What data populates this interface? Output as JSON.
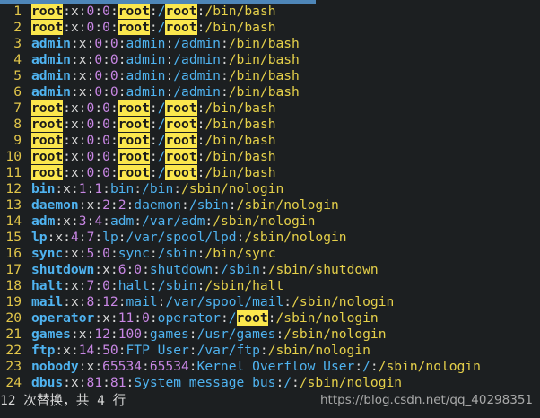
{
  "editor": {
    "lines": [
      {
        "n": "1",
        "user": "root",
        "uid": "0",
        "gid": "0",
        "gecos": "root",
        "home": "/root",
        "shell": "/bin/bash"
      },
      {
        "n": "2",
        "user": "root",
        "uid": "0",
        "gid": "0",
        "gecos": "root",
        "home": "/root",
        "shell": "/bin/bash"
      },
      {
        "n": "3",
        "user": "admin",
        "uid": "0",
        "gid": "0",
        "gecos": "admin",
        "home": "/admin",
        "shell": "/bin/bash"
      },
      {
        "n": "4",
        "user": "admin",
        "uid": "0",
        "gid": "0",
        "gecos": "admin",
        "home": "/admin",
        "shell": "/bin/bash"
      },
      {
        "n": "5",
        "user": "admin",
        "uid": "0",
        "gid": "0",
        "gecos": "admin",
        "home": "/admin",
        "shell": "/bin/bash"
      },
      {
        "n": "6",
        "user": "admin",
        "uid": "0",
        "gid": "0",
        "gecos": "admin",
        "home": "/admin",
        "shell": "/bin/bash"
      },
      {
        "n": "7",
        "user": "root",
        "uid": "0",
        "gid": "0",
        "gecos": "root",
        "home": "/root",
        "shell": "/bin/bash"
      },
      {
        "n": "8",
        "user": "root",
        "uid": "0",
        "gid": "0",
        "gecos": "root",
        "home": "/root",
        "shell": "/bin/bash"
      },
      {
        "n": "9",
        "user": "root",
        "uid": "0",
        "gid": "0",
        "gecos": "root",
        "home": "/root",
        "shell": "/bin/bash"
      },
      {
        "n": "10",
        "user": "root",
        "uid": "0",
        "gid": "0",
        "gecos": "root",
        "home": "/root",
        "shell": "/bin/bash"
      },
      {
        "n": "11",
        "user": "root",
        "uid": "0",
        "gid": "0",
        "gecos": "root",
        "home": "/root",
        "shell": "/bin/bash"
      },
      {
        "n": "12",
        "user": "bin",
        "uid": "1",
        "gid": "1",
        "gecos": "bin",
        "home": "/bin",
        "shell": "/sbin/nologin"
      },
      {
        "n": "13",
        "user": "daemon",
        "uid": "2",
        "gid": "2",
        "gecos": "daemon",
        "home": "/sbin",
        "shell": "/sbin/nologin"
      },
      {
        "n": "14",
        "user": "adm",
        "uid": "3",
        "gid": "4",
        "gecos": "adm",
        "home": "/var/adm",
        "shell": "/sbin/nologin"
      },
      {
        "n": "15",
        "user": "lp",
        "uid": "4",
        "gid": "7",
        "gecos": "lp",
        "home": "/var/spool/lpd",
        "shell": "/sbin/nologin"
      },
      {
        "n": "16",
        "user": "sync",
        "uid": "5",
        "gid": "0",
        "gecos": "sync",
        "home": "/sbin",
        "shell": "/bin/sync"
      },
      {
        "n": "17",
        "user": "shutdown",
        "uid": "6",
        "gid": "0",
        "gecos": "shutdown",
        "home": "/sbin",
        "shell": "/sbin/shutdown"
      },
      {
        "n": "18",
        "user": "halt",
        "uid": "7",
        "gid": "0",
        "gecos": "halt",
        "home": "/sbin",
        "shell": "/sbin/halt"
      },
      {
        "n": "19",
        "user": "mail",
        "uid": "8",
        "gid": "12",
        "gecos": "mail",
        "home": "/var/spool/mail",
        "shell": "/sbin/nologin"
      },
      {
        "n": "20",
        "user": "operator",
        "uid": "11",
        "gid": "0",
        "gecos": "operator",
        "home": "/root",
        "shell": "/sbin/nologin"
      },
      {
        "n": "21",
        "user": "games",
        "uid": "12",
        "gid": "100",
        "gecos": "games",
        "home": "/usr/games",
        "shell": "/sbin/nologin"
      },
      {
        "n": "22",
        "user": "ftp",
        "uid": "14",
        "gid": "50",
        "gecos": "FTP User",
        "home": "/var/ftp",
        "shell": "/sbin/nologin"
      },
      {
        "n": "23",
        "user": "nobody",
        "uid": "65534",
        "gid": "65534",
        "gecos": "Kernel Overflow User",
        "home": "/",
        "shell": "/sbin/nologin"
      },
      {
        "n": "24",
        "user": "dbus",
        "uid": "81",
        "gid": "81",
        "gecos": "System message bus",
        "home": "/",
        "shell": "/sbin/nologin"
      }
    ],
    "password_field": "x",
    "highlight_term": "root"
  },
  "status_message": "12 次替换，共 4 行",
  "watermark": "https://blog.csdn.net/qq_40298351",
  "colors": {
    "background": "#1c1f21",
    "line_number": "#e2c64a",
    "username": "#4fb3f0",
    "numeric": "#c987e5",
    "shell": "#e5d04a",
    "search_highlight": "#fbe74d"
  }
}
